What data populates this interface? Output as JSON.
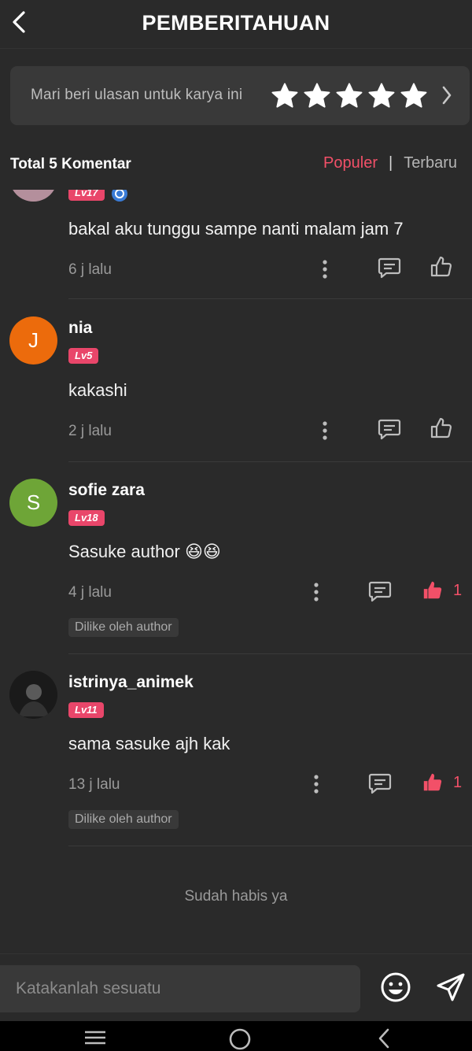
{
  "header": {
    "title": "PEMBERITAHUAN"
  },
  "rating": {
    "prompt": "Mari beri ulasan untuk karya ini",
    "stars": 5
  },
  "filter": {
    "total": "Total 5 Komentar",
    "popular": "Populer",
    "separator": "|",
    "newest": "Terbaru"
  },
  "comments": [
    {
      "username": "",
      "level": "Lv17",
      "text": "bakal aku tunggu sampe nanti malam jam 7",
      "time": "6 j lalu",
      "likes": "",
      "liked_by_author": ""
    },
    {
      "username": "nia",
      "avatar_letter": "J",
      "avatar_color": "#ec6b0c",
      "level": "Lv5",
      "text": "kakashi",
      "time": "2 j lalu",
      "likes": "",
      "liked_by_author": ""
    },
    {
      "username": "sofie zara",
      "avatar_letter": "S",
      "avatar_color": "#6ea537",
      "level": "Lv18",
      "text": "Sasuke author 😆😆",
      "time": "4 j lalu",
      "likes": "1",
      "liked_by_author": "Dilike oleh author"
    },
    {
      "username": "istrinya_animek",
      "level": "Lv11",
      "text": "sama sasuke ajh kak",
      "time": "13 j lalu",
      "likes": "1",
      "liked_by_author": "Dilike oleh author"
    }
  ],
  "end_text": "Sudah habis ya",
  "input": {
    "placeholder": "Katakanlah sesuatu"
  },
  "colors": {
    "accent": "#f25068",
    "background": "#2a2a2a",
    "card": "#393939",
    "level_badge": "#e9466a"
  }
}
